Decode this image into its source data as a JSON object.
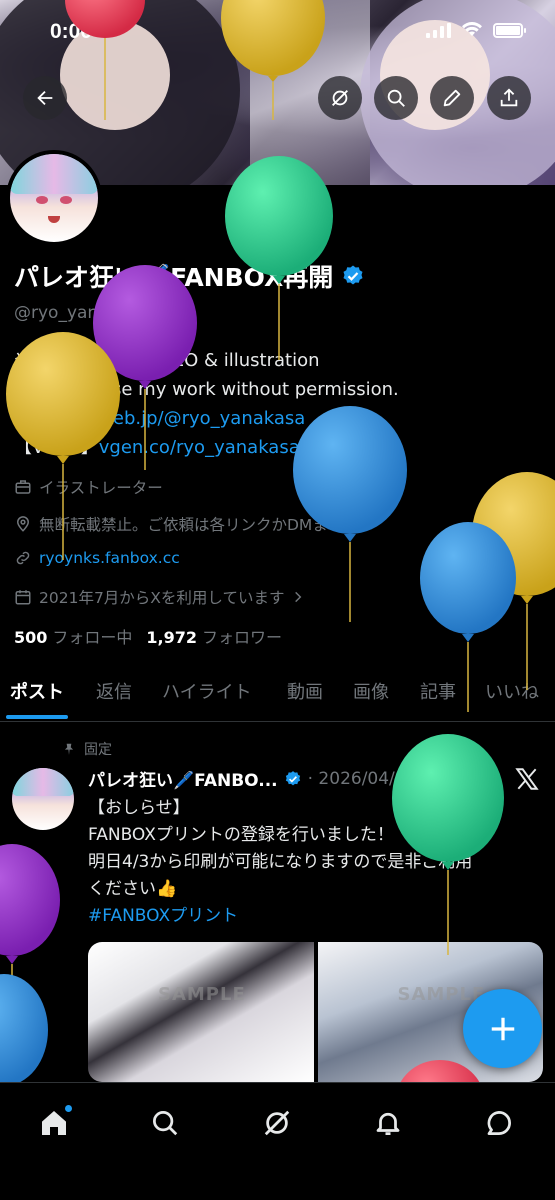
{
  "status_bar": {
    "time": "0:00"
  },
  "profile": {
    "display_name": "パレオ狂い🖊️FANBOX再開",
    "handle": "@ryo_yanakasa",
    "bio_line1": "やなかさです。PAREO & illustration",
    "bio_line2": "※ Do not use my work without permission.",
    "bio_line3_prefix": "【Skeb】",
    "bio_line3_link": "skeb.jp/@ryo_yanakasa",
    "bio_line4_prefix": "【VGen】",
    "bio_line4_link": "vgen.co/ryo_yanakasa",
    "profession": "イラストレーター",
    "location": "無断転載禁止。ご依頼は各リンクかDMまで。",
    "website": "ryoynks.fanbox.cc",
    "joined": "2021年7月からXを利用しています",
    "following_count": "500",
    "following_label": "フォロー中",
    "followers_count": "1,972",
    "followers_label": "フォロワー"
  },
  "tabs": [
    {
      "label": "ポスト"
    },
    {
      "label": "返信"
    },
    {
      "label": "ハイライト"
    },
    {
      "label": "動画"
    },
    {
      "label": "画像"
    },
    {
      "label": "記事"
    },
    {
      "label": "いいね"
    }
  ],
  "post": {
    "pinned_label": "固定",
    "author_name": "パレオ狂い🖊️FANBO...",
    "date": "· 2026/04/02",
    "line1": "【おしらせ】",
    "line2": "FANBOXプリントの登録を行いました！",
    "line3": "明日4/3から印刷が可能になりますので是非ご利用",
    "line4": "ください👍",
    "hashtag": "#FANBOXプリント",
    "watermark1": "SAMPLE",
    "watermark2": "SAMPLE"
  },
  "colors": {
    "accent": "#1d9bf0",
    "background": "#000000",
    "muted_text": "#71767b"
  },
  "icons": {
    "back": "arrow-left-icon",
    "grok": "grok-icon",
    "search": "search-icon",
    "edit": "pencil-icon",
    "share": "share-icon",
    "home": "home-icon",
    "explore": "search-icon",
    "grok_nav": "grok-icon",
    "notifications": "bell-icon",
    "messages": "chat-icon",
    "compose": "plus-icon"
  }
}
